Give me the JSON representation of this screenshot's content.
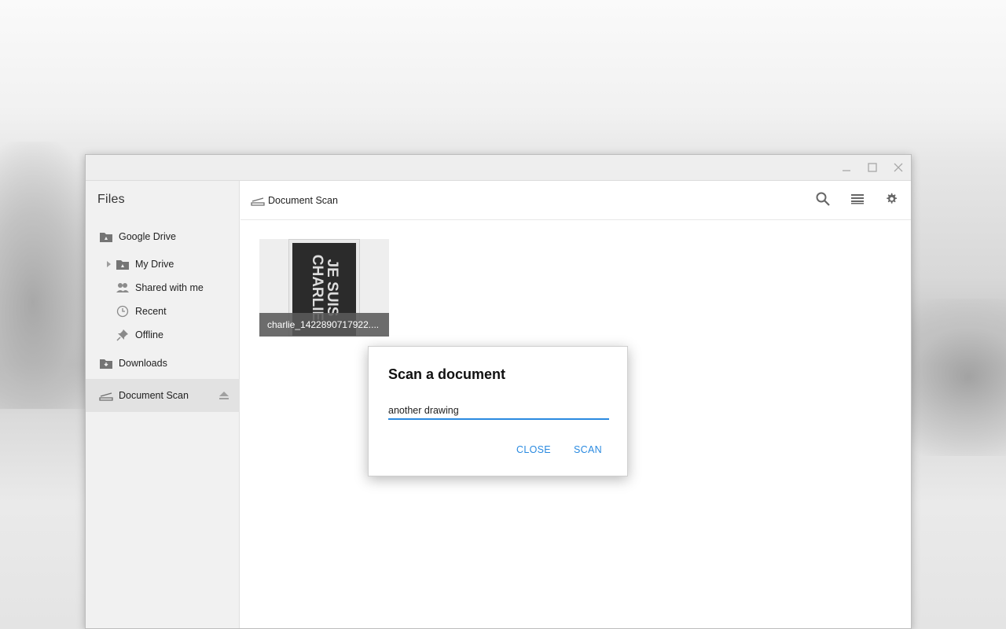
{
  "app": {
    "title": "Files"
  },
  "sidebar": {
    "items": [
      {
        "label": "Google Drive",
        "icon": "drive-folder-icon"
      },
      {
        "label": "My Drive",
        "icon": "drive-folder-icon"
      },
      {
        "label": "Shared with me",
        "icon": "people-icon"
      },
      {
        "label": "Recent",
        "icon": "clock-icon"
      },
      {
        "label": "Offline",
        "icon": "pin-icon"
      },
      {
        "label": "Downloads",
        "icon": "download-folder-icon"
      },
      {
        "label": "Document Scan",
        "icon": "scanner-icon"
      }
    ]
  },
  "toolbar": {
    "breadcrumb": "Document Scan"
  },
  "files": [
    {
      "name": "charlie_1422890717922....",
      "thumb_text": "JE SUIS\nCHARLIE"
    }
  ],
  "dialog": {
    "title": "Scan a document",
    "input_value": "another drawing",
    "close_label": "CLOSE",
    "scan_label": "SCAN"
  },
  "colors": {
    "accent": "#2a8ae0",
    "sidebar_bg": "#f1f1f1",
    "selected_bg": "#e2e2e2"
  }
}
